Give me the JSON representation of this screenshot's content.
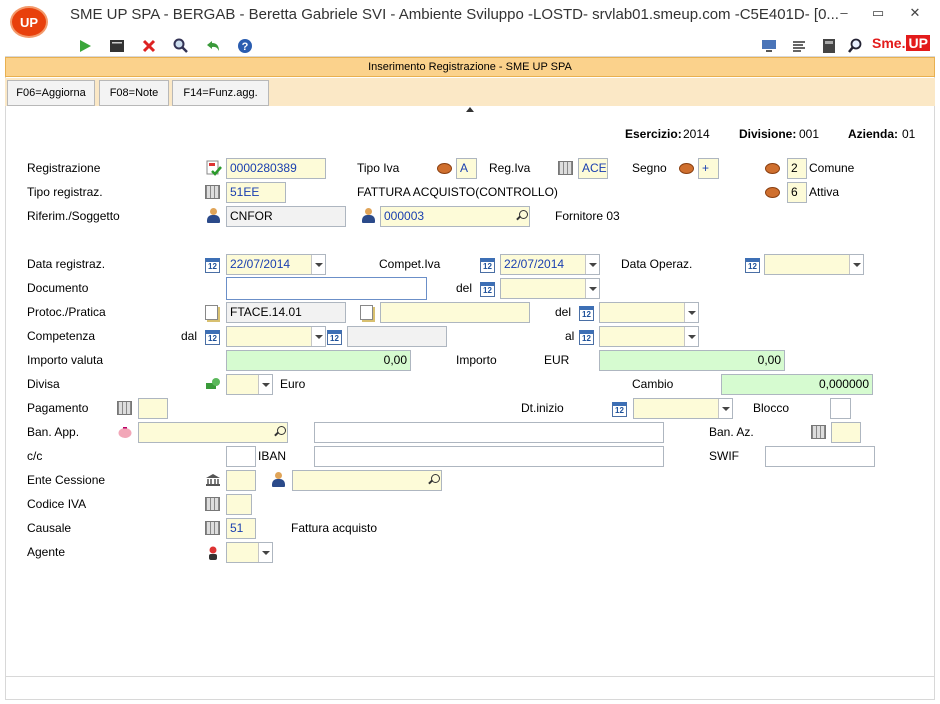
{
  "window": {
    "logo": "UP",
    "title": "SME UP SPA - BERGAB - Beretta Gabriele SVI - Ambiente Sviluppo -LOSTD- srvlab01.smeup.com -C5E401D- [0...",
    "minimize": "–",
    "maximize": "▭",
    "close": "✕"
  },
  "toolbar": {
    "icons": [
      "play-icon",
      "terminal-icon",
      "cancel-icon",
      "search-icon",
      "undo-icon",
      "help-icon",
      "monitor-icon",
      "list-icon",
      "doc-icon",
      "zoom-icon"
    ],
    "brand_a": "Sme.",
    "brand_b": "UP"
  },
  "header": {
    "title": "Inserimento Registrazione -  SME UP SPA"
  },
  "buttons": {
    "f06": "F06=Aggiorna",
    "f08": "F08=Note",
    "f14": "F14=Funz.agg."
  },
  "info": {
    "esercizio_label": "Esercizio:",
    "esercizio": "2014",
    "divisione_label": "Divisione:",
    "divisione": "001",
    "azienda_label": "Azienda:",
    "azienda": "01"
  },
  "labels": {
    "registrazione": "Registrazione",
    "tipo_iva": "Tipo Iva",
    "reg_iva": "Reg.Iva",
    "segno": "Segno",
    "comune": "Comune",
    "tipo_registraz": "Tipo registraz.",
    "attiva": "Attiva",
    "riferim": "Riferim./Soggetto",
    "data_registraz": "Data registraz.",
    "compet_iva": "Compet.Iva",
    "data_operaz": "Data Operaz.",
    "documento": "Documento",
    "del": "del",
    "protoc": "Protoc./Pratica",
    "del2": "del",
    "competenza": "Competenza",
    "dal": "dal",
    "al": "al",
    "importo_valuta": "Importo valuta",
    "importo": "Importo",
    "eur": "EUR",
    "divisa": "Divisa",
    "euro": "Euro",
    "cambio": "Cambio",
    "pagamento": "Pagamento",
    "dt_inizio": "Dt.inizio",
    "blocco": "Blocco",
    "ban_app": "Ban. App.",
    "ban_az": "Ban. Az.",
    "cc": "c/c",
    "iban": "IBAN",
    "swif": "SWIF",
    "ente_cessione": "Ente Cessione",
    "codice_iva": "Codice IVA",
    "causale": "Causale",
    "agente": "Agente"
  },
  "values": {
    "registrazione": "0000280389",
    "tipo_iva": "A",
    "reg_iva": "ACE",
    "segno": "+",
    "comune_num": "2",
    "attiva_num": "6",
    "tipo_registraz": "51EE",
    "tipo_registraz_desc": "FATTURA ACQUISTO(CONTROLLO)",
    "riferim": "CNFOR",
    "soggetto": "000003",
    "soggetto_desc": "Fornitore 03",
    "data_registraz": "22/07/2014",
    "compet_iva": "22/07/2014",
    "data_operaz": "",
    "documento": "",
    "documento_del": "",
    "protoc": "FTACE.14.01",
    "protoc2": "",
    "protoc_del": "",
    "competenza_dal": "",
    "competenza_dal2": "",
    "competenza_al": "",
    "importo_valuta": "0,00",
    "importo": "0,00",
    "divisa": "",
    "cambio": "0,000000",
    "pagamento": "",
    "dt_inizio": "",
    "blocco": "",
    "ban_app": "",
    "ban_app_desc": "",
    "ban_az": "",
    "cc": "",
    "iban": "",
    "swif": "",
    "ente1": "",
    "ente2": "",
    "codice_iva": "",
    "causale": "51",
    "causale_desc": "Fattura acquisto",
    "agente": ""
  },
  "cal_icon": "12"
}
